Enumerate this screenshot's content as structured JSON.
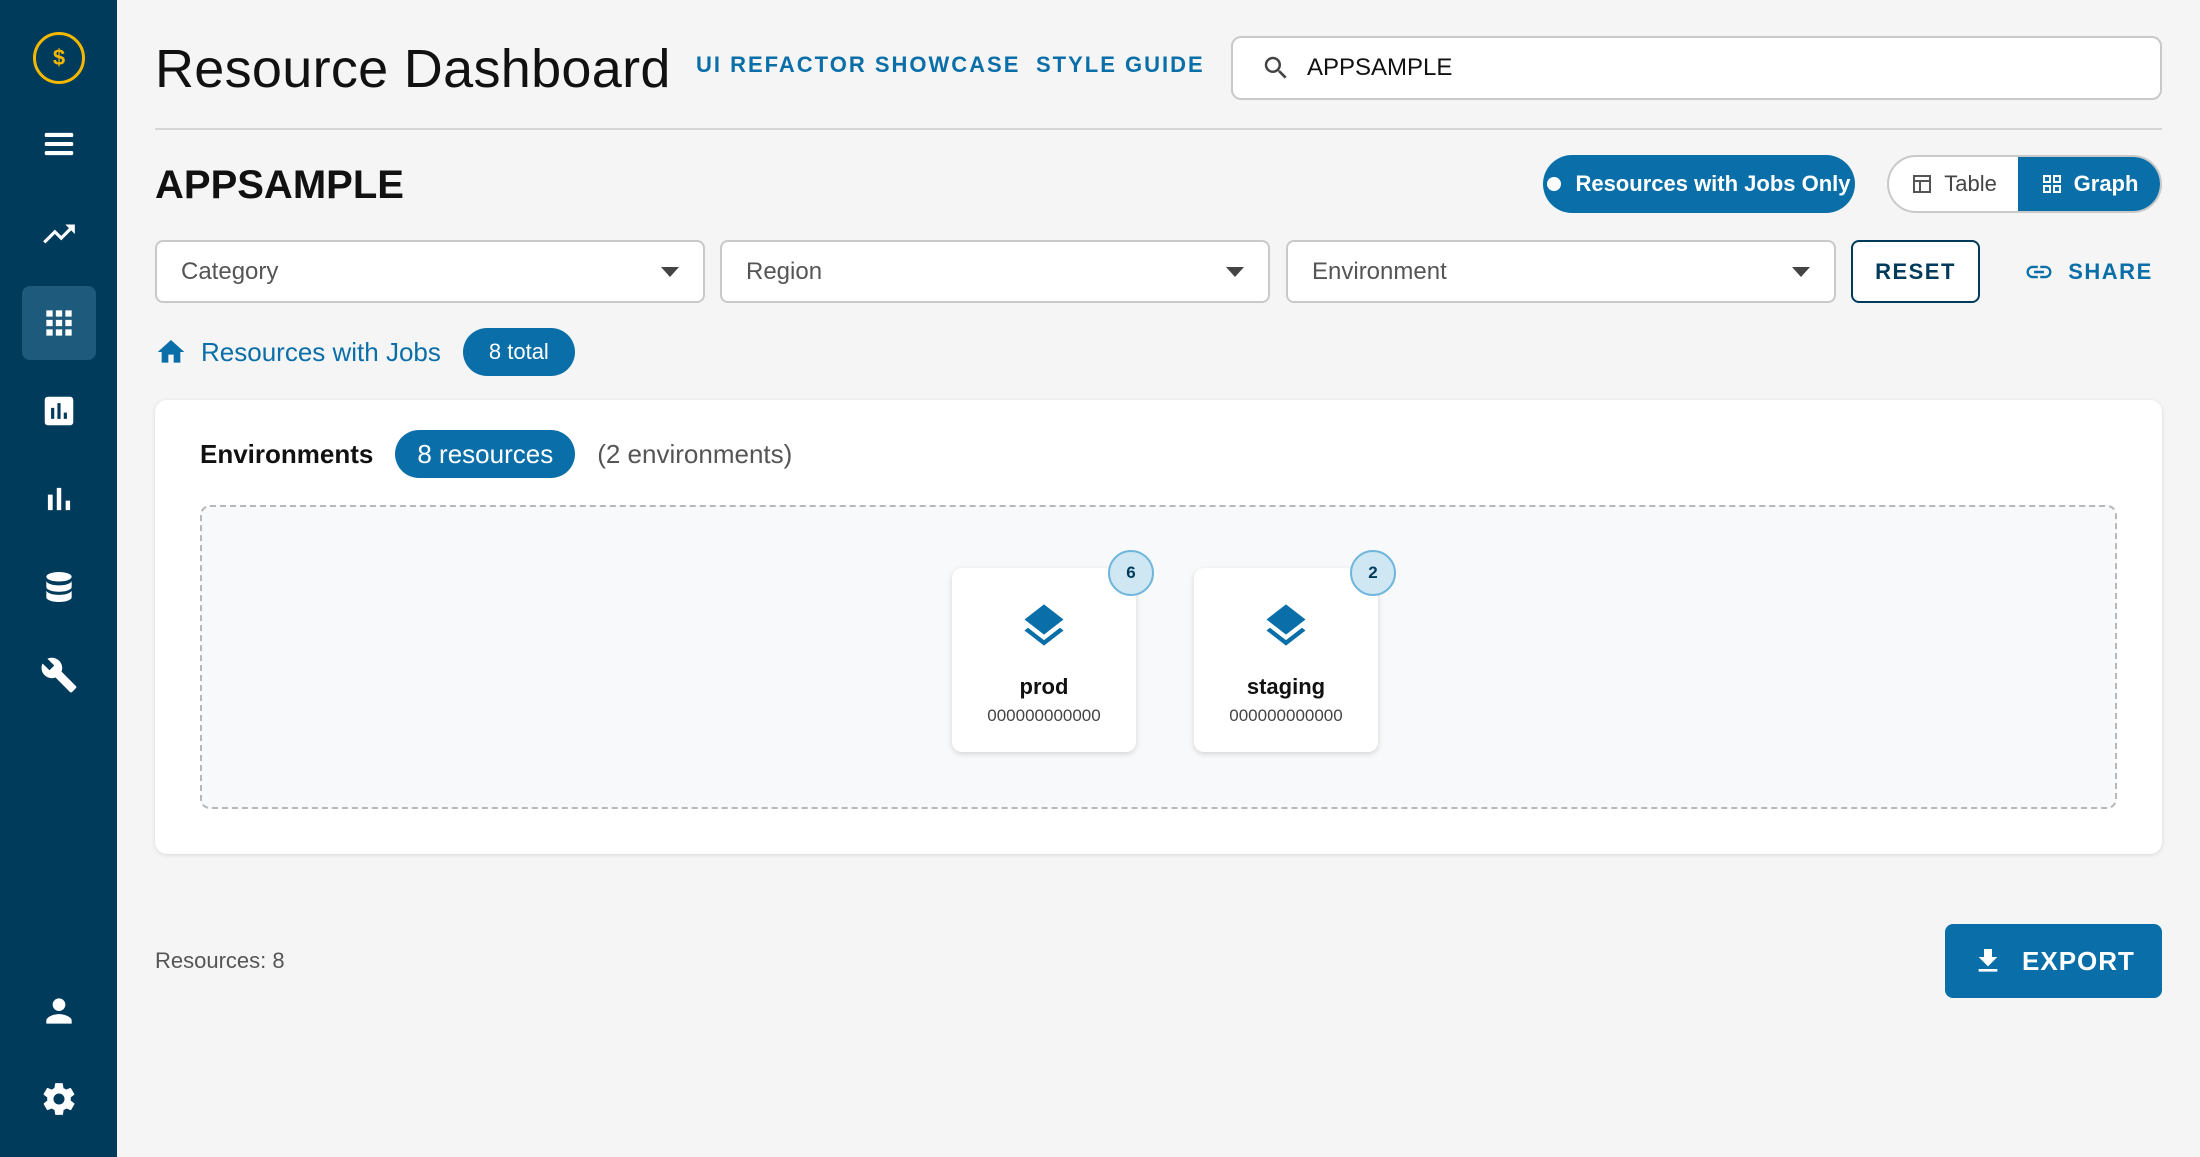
{
  "app": {
    "title": "Resource Dashboard"
  },
  "sidebar": {
    "logo_symbol": "$",
    "items": [
      {
        "icon": "menu-icon"
      },
      {
        "icon": "trending-up-icon"
      },
      {
        "icon": "apps-grid-icon",
        "active": true
      },
      {
        "icon": "assessment-icon"
      },
      {
        "icon": "bar-chart-icon"
      },
      {
        "icon": "database-icon"
      },
      {
        "icon": "wrench-icon"
      },
      {
        "icon": "person-icon"
      },
      {
        "icon": "gear-icon"
      }
    ]
  },
  "header": {
    "nav_links": [
      "UI REFACTOR SHOWCASE",
      "STYLE GUIDE"
    ],
    "search_value": "APPSAMPLE"
  },
  "toolbar": {
    "section_title": "APPSAMPLE",
    "jobs_toggle_label": "Resources with Jobs Only",
    "view_table_label": "Table",
    "view_graph_label": "Graph",
    "active_view": "Graph"
  },
  "filters": {
    "category_placeholder": "Category",
    "region_placeholder": "Region",
    "environment_placeholder": "Environment",
    "reset_label": "RESET",
    "share_label": "SHARE"
  },
  "breadcrumb": {
    "label": "Resources with Jobs",
    "total_badge": "8 total"
  },
  "environments_card": {
    "heading": "Environments",
    "resources_badge": "8 resources",
    "env_count_text": "(2 environments)",
    "items": [
      {
        "name": "prod",
        "id": "000000000000",
        "count": "6"
      },
      {
        "name": "staging",
        "id": "000000000000",
        "count": "2"
      }
    ]
  },
  "footer": {
    "resources_count": "Resources: 8",
    "export_label": "EXPORT"
  },
  "colors": {
    "sidebar_bg": "#003b5c",
    "accent": "#0a6fa8",
    "logo": "#f5b800",
    "background": "#f5f5f5"
  }
}
